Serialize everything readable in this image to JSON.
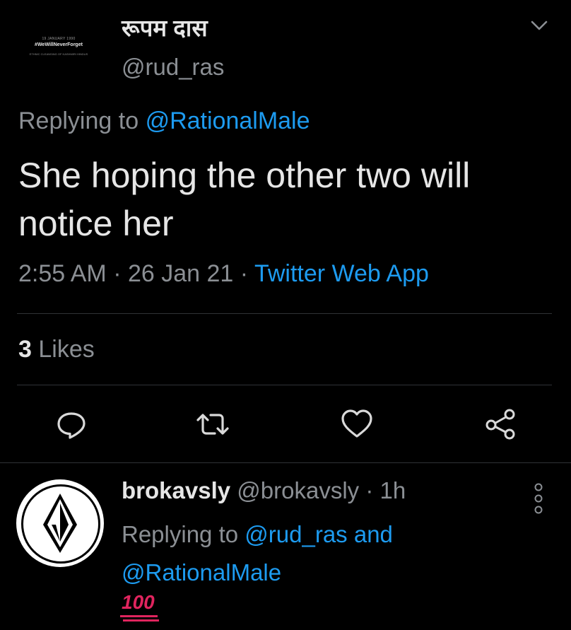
{
  "tweet": {
    "author_name": "रूपम दास",
    "author_handle": "@rud_ras",
    "avatar_text": {
      "line1": "19 JANUARY 1990",
      "line2": "#WeWillNeverForget",
      "line3": "ETHNIC CLEANSING OF KASHMIRI HINDUS"
    },
    "replying_label": "Replying to",
    "replying_to": "@RationalMale",
    "text": "She hoping the other two will notice her",
    "time": "2:55 AM",
    "date": "26 Jan 21",
    "source": "Twitter Web App",
    "separator": "·",
    "likes_count": "3",
    "likes_label": "Likes"
  },
  "actions": [
    "reply-icon",
    "retweet-icon",
    "like-icon",
    "share-icon"
  ],
  "reply": {
    "name": "brokavsly",
    "handle": "@brokavsly",
    "separator": "·",
    "age": "1h",
    "replying_label": "Replying to",
    "replying_to_1": "@rud_ras",
    "and_label": "and",
    "replying_to_2": "@RationalMale",
    "text": "100"
  },
  "colors": {
    "background": "#000000",
    "accent": "#1d9bf0",
    "secondary_text": "#8b8f94",
    "emoji_red": "#e0245e"
  }
}
